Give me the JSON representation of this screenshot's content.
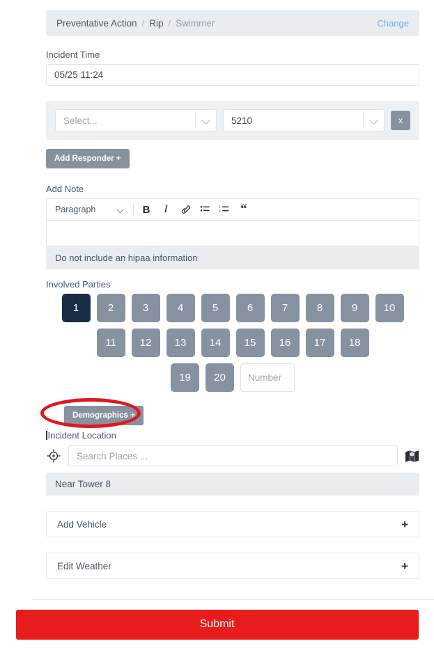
{
  "breadcrumb": {
    "items": [
      {
        "label": "Preventative Action",
        "muted": false
      },
      {
        "label": "Rip",
        "muted": false
      },
      {
        "label": "Swimmer",
        "muted": true
      }
    ],
    "separator": "/",
    "change_label": "Change"
  },
  "incident_time": {
    "label": "Incident Time",
    "value": "05/25 11:24"
  },
  "responder": {
    "type_placeholder": "Select...",
    "id_value": "5210",
    "remove_label": "x",
    "add_label": "Add Responder +"
  },
  "note": {
    "label": "Add Note",
    "format_value": "Paragraph",
    "toolbar": [
      {
        "name": "bold-icon",
        "glyph": "B"
      },
      {
        "name": "italic-icon",
        "glyph": "I"
      },
      {
        "name": "link-icon",
        "glyph": "link"
      },
      {
        "name": "bullet-list-icon",
        "glyph": "ul"
      },
      {
        "name": "numbered-list-icon",
        "glyph": "ol"
      },
      {
        "name": "blockquote-icon",
        "glyph": "“"
      }
    ],
    "body_value": "",
    "hint": "Do not include an hipaa information"
  },
  "involved_parties": {
    "label": "Involved Parties",
    "selected": 1,
    "rows": [
      [
        "1",
        "2",
        "3",
        "4",
        "5",
        "6",
        "7",
        "8",
        "9",
        "10"
      ],
      [
        "11",
        "12",
        "13",
        "14",
        "15",
        "16",
        "17",
        "18"
      ],
      [
        "19",
        "20"
      ]
    ],
    "number_input_placeholder": "Number",
    "number_input_value": ""
  },
  "demographics": {
    "button_label": "Demographics +",
    "annotation_color": "#e3161c"
  },
  "location": {
    "label": "Incident Location",
    "search_placeholder": "Search Places ...",
    "search_value": "",
    "result": "Near Tower 8",
    "geolocate_icon": "crosshair-target-icon",
    "map_icon": "folded-map-icon"
  },
  "sections": [
    {
      "label": "Add Vehicle",
      "toggle": "+"
    },
    {
      "label": "Edit Weather",
      "toggle": "+"
    }
  ],
  "submit": {
    "label": "Submit",
    "color": "#e81c1c"
  },
  "colors": {
    "selected_button": "#1b2d45",
    "gray_button": "#8792a0",
    "link": "#6cb2eb",
    "panel": "#e9edf0"
  }
}
